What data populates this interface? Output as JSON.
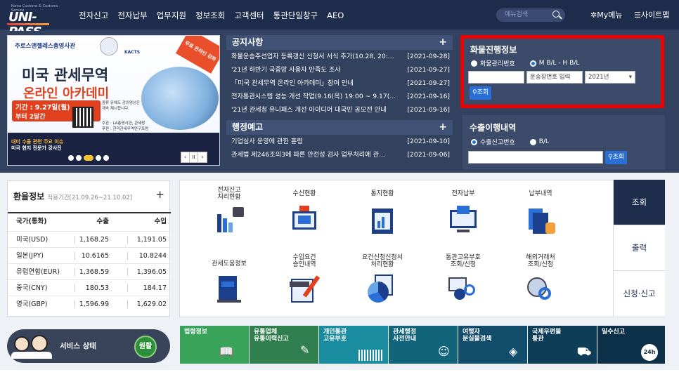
{
  "header": {
    "logo_small": "Korea Customs & Customs Service",
    "logo": "UNI-PASS",
    "nav": [
      "전자신고",
      "전자납부",
      "업무지원",
      "정보조회",
      "고객센터",
      "통관단일창구",
      "AEO"
    ],
    "search_placeholder": "메뉴검색",
    "my_menu": "My메뉴",
    "sitemap": "사이트맵"
  },
  "banner": {
    "org": "주로스앤젤레스총영사관",
    "kacts": "KACTS",
    "badge": "무료 온라인 강좌",
    "title1": "미국 관세무역",
    "title2": "온라인 아카데미",
    "period_label": "기간 : 9.27일(월)",
    "period_sub": "부터 2달간",
    "desc": "종류 유예도 강의영상은 계속 제시합니다.",
    "host": "주관 : LA총영사관, 관세청",
    "host2": "후원 : 한미관세무역연구포럼",
    "promo1": "대미 수출 관련 주요 이슈",
    "promo2": "미국 현지 전문가 강사진",
    "slide_pause": "II"
  },
  "notice": {
    "title": "공지사항",
    "items": [
      {
        "text": "화물운송주선업자 등록갱신 신청서 서식 추가(10.28, 20:...",
        "date": "[2021-09-28]"
      },
      {
        "text": "'21년 하반기 국종망 사용자 만족도 조사",
        "date": "[2021-09-27]"
      },
      {
        "text": "「미국 관세무역 온라인 아카데미」참여 안내",
        "date": "[2021-09-27]"
      },
      {
        "text": "전자통관시스템 성능 개선 작업(9.16(목) 19:00 ~ 9.17(...",
        "date": "[2021-09-16]"
      },
      {
        "text": "'21년 관세청 유니패스 개선 아이디어 대국민 공모전 안내",
        "date": "[2021-09-16]"
      }
    ]
  },
  "admin": {
    "title": "행정예고",
    "items": [
      {
        "text": "기업심사 운영에 관한 훈령",
        "date": "[2021-09-10]"
      },
      {
        "text": "관세법 제246조의3에 따른 안전성 검사 업무처리에 관...",
        "date": "[2021-09-06]"
      }
    ]
  },
  "cargo": {
    "title": "화물진행정보",
    "radio1": "화물관리번호",
    "radio2": "M B/L - H B/L",
    "placeholder": "운송장번호 입력",
    "year": "2021년",
    "button": "조회"
  },
  "export": {
    "title": "수출이행내역",
    "radio1": "수출신고번호",
    "radio2": "B/L",
    "button": "조회"
  },
  "fx": {
    "title": "환율정보",
    "period": "적용기간[21.09.26~21.10.02]",
    "cols": [
      "국가(통화)",
      "수출",
      "수입"
    ],
    "rows": [
      [
        "미국(USD)",
        "1,168.25",
        "1,191.05"
      ],
      [
        "일본(JPY)",
        "10.6165",
        "10.8244"
      ],
      [
        "유럽연합(EUR)",
        "1,368.59",
        "1,396.05"
      ],
      [
        "중국(CNY)",
        "180.53",
        "184.17"
      ],
      [
        "영국(GBP)",
        "1,596.99",
        "1,629.02"
      ]
    ]
  },
  "services": {
    "row1": [
      {
        "label": "전자신고\n처리현황",
        "icon": "bar-chart-icon"
      },
      {
        "label": "수신현황",
        "icon": "inbox-monitor-icon"
      },
      {
        "label": "통지현황",
        "icon": "notice-chart-icon"
      },
      {
        "label": "전자납부",
        "icon": "payment-monitor-icon"
      },
      {
        "label": "납부내역",
        "icon": "payment-history-icon"
      }
    ],
    "row2": [
      {
        "label": "관세도움정보",
        "icon": "help-book-icon"
      },
      {
        "label": "수입요건\n승인내역",
        "icon": "import-document-icon"
      },
      {
        "label": "요건신청신청서\n처리현황",
        "icon": "pie-document-icon"
      },
      {
        "label": "통관고유부호\n조회/신청",
        "icon": "person-search-icon"
      },
      {
        "label": "해외거래처\n조회/신청",
        "icon": "globe-search-icon"
      }
    ],
    "tabs": [
      "조회",
      "출력",
      "신청·신고"
    ]
  },
  "service_status": {
    "label": "서비스 상태",
    "state": "원활"
  },
  "tiles": [
    {
      "label": "법령정보",
      "color": "#3aa35a"
    },
    {
      "label": "유통업체\n유통이력신고",
      "color": "#2f7f4f"
    },
    {
      "label": "개인통관\n고유부호",
      "color": "#1a8ca0"
    },
    {
      "label": "관세행정\n사전안내",
      "color": "#12647a"
    },
    {
      "label": "여행자\n분실물검색",
      "color": "#124e6b"
    },
    {
      "label": "국제우편물\n통관",
      "color": "#0e3d58"
    },
    {
      "label": "밀수신고",
      "color": "#0b3048"
    }
  ]
}
